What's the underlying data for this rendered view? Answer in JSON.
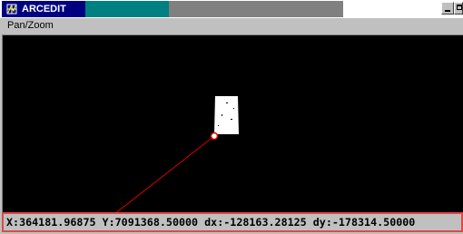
{
  "window": {
    "title": "ARCEDIT",
    "app_icon": "arc-grid-icon",
    "minimize_icon": "minimize-icon",
    "maximize_icon": "maximize-icon"
  },
  "menu": {
    "items": [
      "Pan/Zoom"
    ]
  },
  "status": {
    "coordinates": "X:364181.96875 Y:7091368.50000 dx:-128163.28125 dy:-178314.50000"
  },
  "colors": {
    "title_active": "#000080",
    "title_teal": "#008080",
    "title_inactive": "#808080",
    "canvas_bg": "#000000",
    "feature": "#ffffff",
    "rubber_band": "#e00000",
    "status_highlight": "#e04848"
  }
}
